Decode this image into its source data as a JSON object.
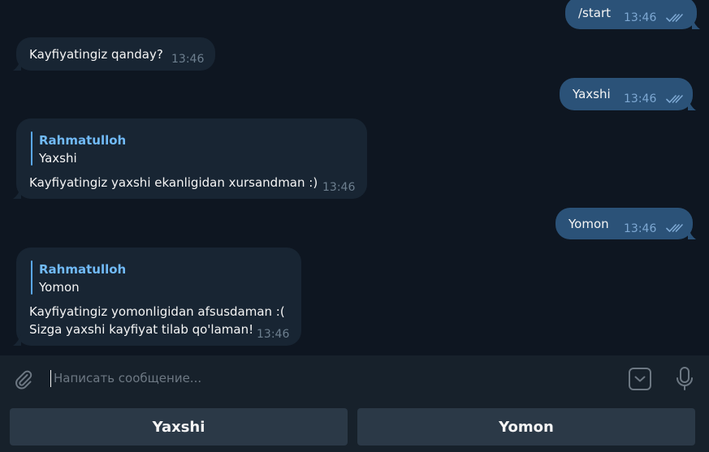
{
  "colors": {
    "background": "#0e1621",
    "incoming_bubble": "#182533",
    "outgoing_bubble": "#2b5278",
    "accent": "#5aa7e8",
    "panel": "#17212b",
    "keyboard_button": "#2b3947"
  },
  "messages": [
    {
      "direction": "out",
      "text": "/start",
      "time": "13:46",
      "status": "read"
    },
    {
      "direction": "in",
      "text": "Kayfiyatingiz qanday?",
      "time": "13:46"
    },
    {
      "direction": "out",
      "text": "Yaxshi",
      "time": "13:46",
      "status": "read"
    },
    {
      "direction": "in",
      "reply_to": {
        "name": "Rahmatulloh",
        "text": "Yaxshi"
      },
      "text": "Kayfiyatingiz yaxshi ekanligidan xursandman :)",
      "time": "13:46"
    },
    {
      "direction": "out",
      "text": "Yomon",
      "time": "13:46",
      "status": "read"
    },
    {
      "direction": "in",
      "reply_to": {
        "name": "Rahmatulloh",
        "text": "Yomon"
      },
      "lines": [
        "Kayfiyatingiz yomonligidan afsusdaman :(",
        "Sizga yaxshi kayfiyat tilab qo'laman!"
      ],
      "time": "13:46"
    }
  ],
  "composer": {
    "placeholder": "Написать сообщение...",
    "attach_icon": "paperclip-icon",
    "sticker_icon": "sticker-icon",
    "mic_icon": "microphone-icon"
  },
  "reply_keyboard": {
    "buttons": [
      "Yaxshi",
      "Yomon"
    ]
  }
}
